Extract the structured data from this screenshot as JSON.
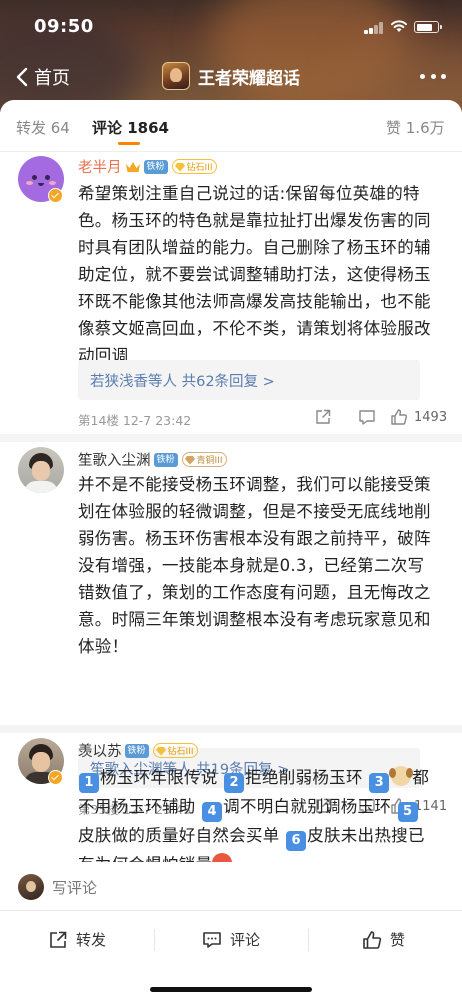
{
  "status_bar": {
    "time": "09:50"
  },
  "nav": {
    "back_label": "首页",
    "title": "王者荣耀超话"
  },
  "tabs": {
    "repost": "转发 64",
    "comments": "评论 1864",
    "likes": "赞 1.6万"
  },
  "comments": [
    {
      "username": "老半月",
      "fan_badge": "铁粉",
      "level_badge": "钻石III",
      "text": "希望策划注重自己说过的话:保留每位英雄的特色。杨玉环的特色就是靠拉扯打出爆发伤害的同时具有团队增益的能力。自己删除了杨玉环的辅助定位，就不要尝试调整辅助打法，这使得杨玉环既不能像其他法师高爆发高技能输出，也不能像蔡文姬高回血，不伦不类，请策划将体验服改动回调",
      "reply_summary": "若狭浅香等人  共62条回复 >",
      "meta": "第14楼  12-7 23:42",
      "likes": "1493"
    },
    {
      "username": "笙歌入尘渊",
      "fan_badge": "铁粉",
      "level_badge": "青铜III",
      "text": "并不是不能接受杨玉环调整，我们可以能接受策划在体验服的轻微调整，但是不接受无底线地削弱伤害。杨玉环伤害根本没有跟之前持平，破阵没有增强，一技能本身就是0.3，已经第二次写错数值了，策划的工作态度有问题，且无悔改之意。时隔三年策划调整根本没有考虑玩家意见和体验！",
      "reply_summary": "笙歌入尘渊等人  共19条回复 >",
      "meta": "第35楼  12-7 23:43",
      "likes": "1141"
    },
    {
      "username": "羡以苏",
      "fan_badge": "铁粉",
      "level_badge": "钻石III",
      "segments": [
        "1",
        "杨玉环年限传说 ",
        "2",
        "拒绝削弱杨玉环 ",
        "3",
        "都不用杨玉环辅助 ",
        "4",
        "调不明白就别调杨玉环 ",
        "5",
        "皮肤做的质量好自然会买单 ",
        "6",
        "皮肤未出热搜已有为何会惧怕销量"
      ]
    }
  ],
  "compose": {
    "placeholder": "写评论"
  },
  "toolbar": {
    "repost": "转发",
    "comment": "评论",
    "like": "赞"
  }
}
